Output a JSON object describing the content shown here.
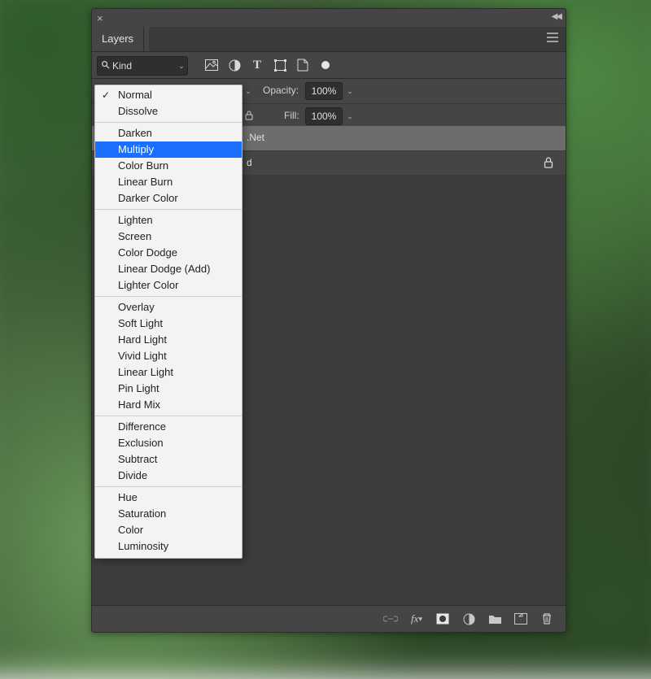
{
  "panel": {
    "tab_label": "Layers"
  },
  "filter": {
    "kind_label": "Kind",
    "icons": [
      "image",
      "adjustment",
      "type",
      "shape",
      "smart",
      "artboard-dot"
    ]
  },
  "opacity_row": {
    "label": "Opacity:",
    "value": "100%"
  },
  "fill_row": {
    "label": "Fill:",
    "value": "100%"
  },
  "layers": [
    {
      "name": ".Net",
      "selected": true,
      "locked": false
    },
    {
      "name": "d",
      "selected": false,
      "locked": true
    }
  ],
  "footer_icons": [
    "link",
    "fx",
    "mask",
    "adjustment",
    "group",
    "new-layer",
    "trash"
  ],
  "blend_menu": {
    "checked": "Normal",
    "selected": "Multiply",
    "groups": [
      [
        "Normal",
        "Dissolve"
      ],
      [
        "Darken",
        "Multiply",
        "Color Burn",
        "Linear Burn",
        "Darker Color"
      ],
      [
        "Lighten",
        "Screen",
        "Color Dodge",
        "Linear Dodge (Add)",
        "Lighter Color"
      ],
      [
        "Overlay",
        "Soft Light",
        "Hard Light",
        "Vivid Light",
        "Linear Light",
        "Pin Light",
        "Hard Mix"
      ],
      [
        "Difference",
        "Exclusion",
        "Subtract",
        "Divide"
      ],
      [
        "Hue",
        "Saturation",
        "Color",
        "Luminosity"
      ]
    ]
  }
}
